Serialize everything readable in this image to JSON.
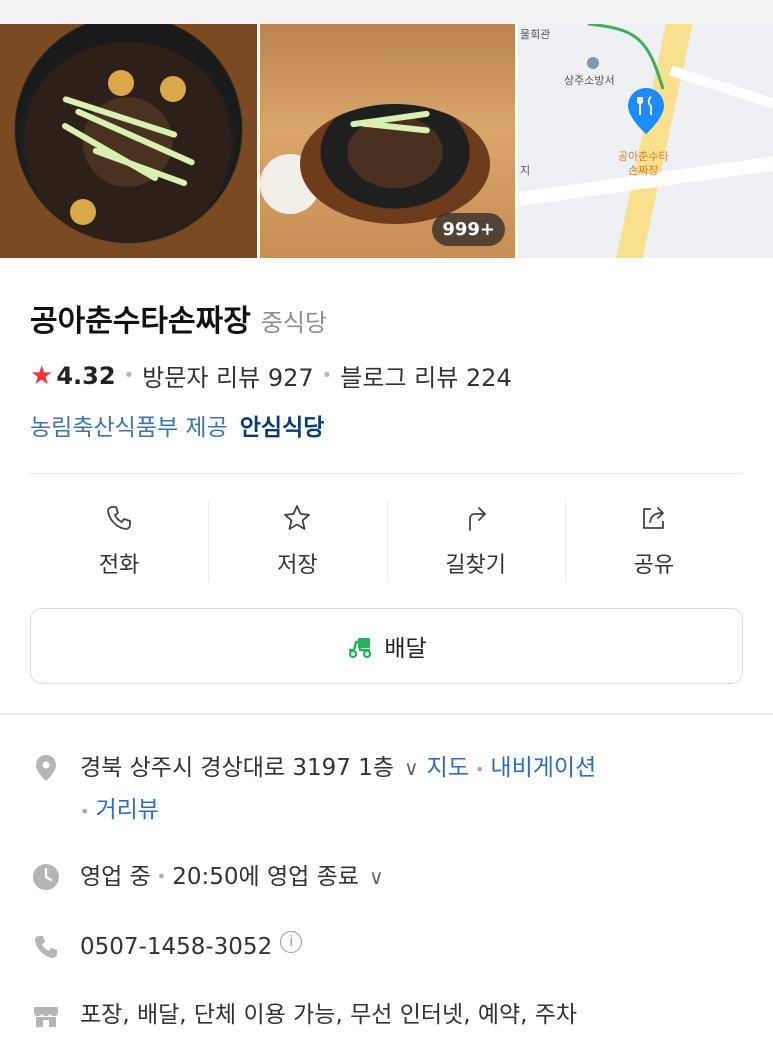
{
  "gallery": {
    "photo_count": "999+",
    "map": {
      "labels": [
        "물회관",
        "상주소방서",
        "지"
      ],
      "pin_label_line1": "공아춘수타",
      "pin_label_line2": "손짜장"
    }
  },
  "place": {
    "name": "공아춘수타손짜장",
    "category": "중식당",
    "rating": "4.32",
    "visitor_reviews": "방문자 리뷰 927",
    "blog_reviews": "블로그 리뷰 224",
    "provider": "농림축산식품부 제공",
    "safe_badge": "안심식당"
  },
  "actions": [
    {
      "label": "전화",
      "icon": "phone-icon"
    },
    {
      "label": "저장",
      "icon": "star-icon"
    },
    {
      "label": "길찾기",
      "icon": "directions-icon"
    },
    {
      "label": "공유",
      "icon": "share-icon"
    }
  ],
  "delivery": {
    "label": "배달",
    "icon": "delivery-scooter-icon"
  },
  "info": {
    "address": "경북 상주시 경상대로 3197 1층",
    "map_link": "지도",
    "navigation_link": "내비게이션",
    "street_view_link": "거리뷰",
    "hours_status": "영업 중",
    "hours_detail": "20:50에 영업 종료",
    "phone": "0507-1458-3052",
    "amenities": "포장, 배달, 단체 이용 가능, 무선 인터넷, 예약, 주차"
  },
  "colors": {
    "link_blue": "#2b6bc9",
    "star_red": "#f0333a",
    "delivery_green": "#21b35a",
    "pin_blue": "#1d8cf8"
  }
}
